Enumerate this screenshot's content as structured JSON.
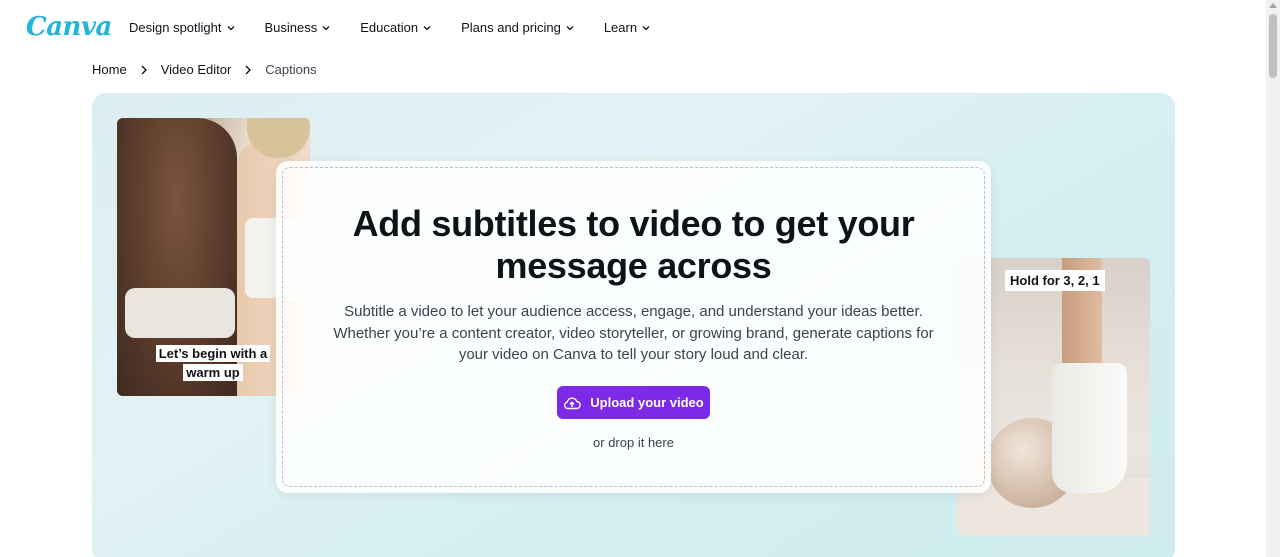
{
  "brand": {
    "logo_text": "Canva",
    "logo_color": "#1fb6d9",
    "accent": "#7d2ae8"
  },
  "nav": {
    "items": [
      {
        "label": "Design spotlight"
      },
      {
        "label": "Business"
      },
      {
        "label": "Education"
      },
      {
        "label": "Plans and pricing"
      },
      {
        "label": "Learn"
      }
    ]
  },
  "breadcrumb": {
    "items": [
      {
        "label": "Home"
      },
      {
        "label": "Video Editor"
      },
      {
        "label": "Captions"
      }
    ]
  },
  "hero": {
    "title": "Add subtitles to video to get your message across",
    "description": "Subtitle a video to let your audience access, engage, and understand your ideas better. Whether you’re a content creator, video storyteller, or growing brand, generate captions for your video on Canva to tell your story loud and clear.",
    "upload_button": "Upload your video",
    "drop_text": "or drop it here",
    "left_caption": "Let’s begin with a warm up",
    "right_caption": "Hold for 3, 2, 1",
    "icons": {
      "upload": "cloud-upload-icon",
      "nav_chevron": "chevron-down-icon",
      "breadcrumb_separator": "chevron-right-icon"
    }
  }
}
